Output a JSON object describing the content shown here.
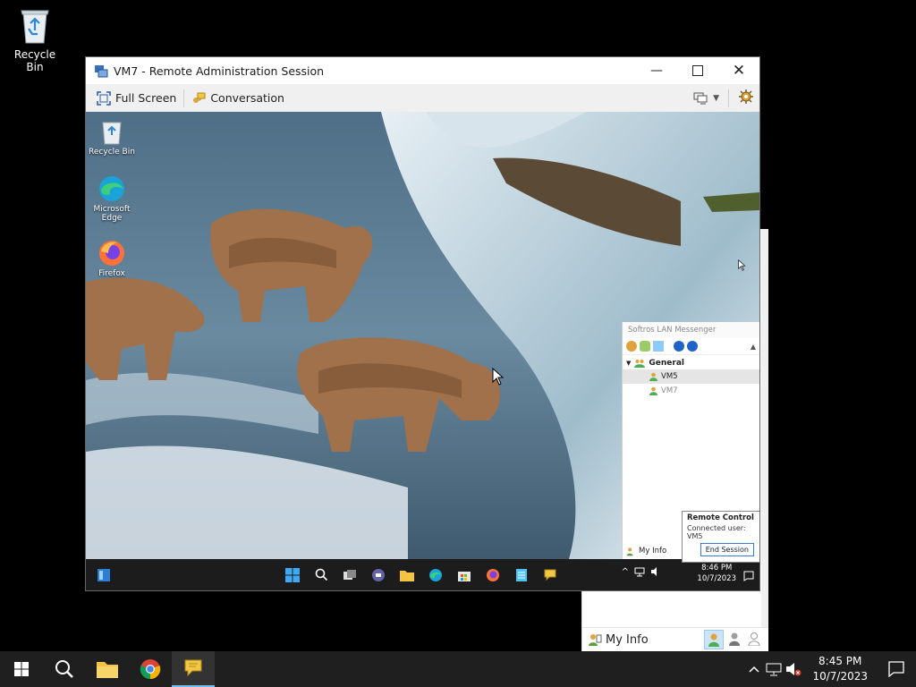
{
  "host_desktop": {
    "recycle_bin_label": "Recycle Bin"
  },
  "remote_window": {
    "title": "VM7 - Remote Administration Session",
    "toolbar": {
      "full_screen_label": "Full Screen",
      "conversation_label": "Conversation"
    }
  },
  "remote_desktop": {
    "icons": [
      {
        "label": "Recycle Bin",
        "icon": "recycle-bin-icon"
      },
      {
        "label": "Microsoft Edge",
        "icon": "edge-icon"
      },
      {
        "label": "Firefox",
        "icon": "firefox-icon"
      }
    ],
    "messenger": {
      "title": "Softros LAN Messenger",
      "group": "General",
      "users": [
        {
          "name": "VM5",
          "selected": true
        },
        {
          "name": "VM7",
          "selected": false
        }
      ],
      "my_info": "My Info"
    },
    "remote_control_popup": {
      "title": "Remote Control",
      "status": "Connected user: VM5",
      "end_button": "End Session"
    },
    "taskbar": {
      "time": "8:46 PM",
      "date": "10/7/2023"
    }
  },
  "host_messenger_panel": {
    "my_info": "My Info"
  },
  "host_taskbar": {
    "time": "8:45 PM",
    "date": "10/7/2023"
  },
  "colors": {
    "accent": "#76b9ed",
    "taskbar": "#1f1f1f"
  }
}
